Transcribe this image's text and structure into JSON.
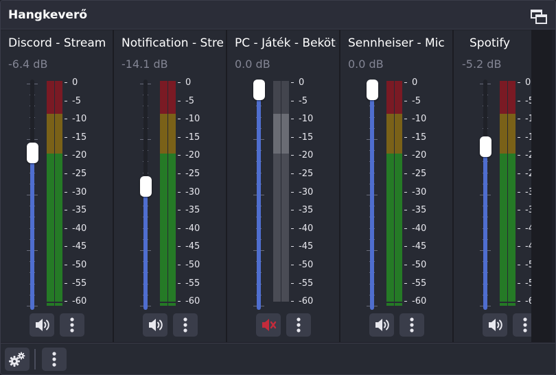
{
  "dock": {
    "title": "Hangkeverő",
    "float_icon": "undock-window-icon"
  },
  "colors": {
    "fader_fill": "#4f6ecf",
    "meter_green": "#257a26",
    "meter_yellow": "#7a6118",
    "meter_red": "#7a1a24",
    "meter_muted": "#5a5c66",
    "mute_red": "#c42b3b"
  },
  "meter_scale": [
    "0",
    "-5",
    "-10",
    "-15",
    "-20",
    "-25",
    "-30",
    "-35",
    "-40",
    "-45",
    "-50",
    "-55",
    "-60"
  ],
  "channels": [
    {
      "name": "Discord - Stream",
      "db": "-6.4 dB",
      "level": 0.7,
      "muted": false,
      "mute_icon": "speaker-icon",
      "menu_icon": "more-vertical-icon"
    },
    {
      "name": "Notification - Stream",
      "db": "-14.1 dB",
      "level": 0.54,
      "muted": false,
      "mute_icon": "speaker-icon",
      "menu_icon": "more-vertical-icon"
    },
    {
      "name": "PC - Játék - Bekötés",
      "db": "0.0 dB",
      "level": 1.0,
      "muted": true,
      "mute_icon": "speaker-muted-icon",
      "menu_icon": "more-vertical-icon"
    },
    {
      "name": "Sennheiser - Mic",
      "db": "0.0 dB",
      "level": 1.0,
      "muted": false,
      "mute_icon": "speaker-icon",
      "menu_icon": "more-vertical-icon"
    },
    {
      "name": "Spotify",
      "db": "-5.2 dB",
      "level": 0.73,
      "muted": false,
      "mute_icon": "speaker-icon",
      "menu_icon": "more-vertical-icon"
    }
  ],
  "toolbar": {
    "settings_icon": "gears-icon",
    "menu_icon": "more-vertical-icon"
  }
}
